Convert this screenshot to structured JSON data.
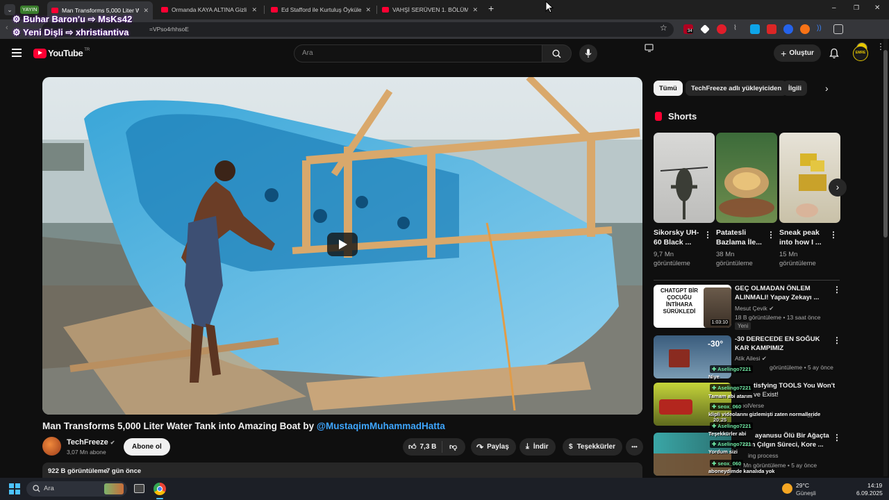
{
  "browser": {
    "live_badge": "YAYIN",
    "tabs": [
      {
        "title": "Man Transforms 5,000 Liter Wa",
        "active": true
      },
      {
        "title": "Ormanda KAYA ALTINA Gizli Ev"
      },
      {
        "title": "Ed Stafford ile Kurtuluş Öyküleri"
      },
      {
        "title": "VAHŞİ SERÜVEN 1. BÖLÜM | 4K"
      }
    ],
    "new_tab": "+",
    "url_fragment": "=VPso4rhhsoE",
    "window_controls": {
      "minimize": "–",
      "restore": "❐",
      "close": "✕"
    },
    "ext_badge": "34"
  },
  "stream_overlay": {
    "line1": "Buhar Baron'u ⇨ MsKs42",
    "line2": "Yeni Dişli ⇨ xhristiantiva"
  },
  "header": {
    "logo": "YouTube",
    "logo_region": "TR",
    "search_placeholder": "Ara",
    "create_label": "Oluştur",
    "avatar_label": "EMRE B."
  },
  "video": {
    "title_prefix": "Man Transforms 5,000 Liter Water Tank into Amazing Boat by ",
    "title_mention": "@MustaqimMuhammadHatta",
    "channel": "TechFreeze",
    "subscribers": "3,07 Mn abone",
    "subscribe_label": "Abone ol",
    "likes": "7,3 B",
    "share_label": "Paylaş",
    "download_label": "İndir",
    "thanks_label": "Teşekkürler",
    "more": "•••",
    "views": "922 B görüntüleme",
    "age": "7 gün önce"
  },
  "filter_chips": [
    "Tümü",
    "TechFreeze adlı yükleyiciden",
    "İlgili"
  ],
  "shorts": {
    "heading": "Shorts",
    "items": [
      {
        "title": "Sikorsky UH-60 Black ...",
        "views": "9,7 Mn görüntüleme"
      },
      {
        "title": "Patatesli Bazlama İle...",
        "views": "38 Mn görüntüleme"
      },
      {
        "title": "Sneak peak into how I ...",
        "views": "15 Mn görüntüleme"
      }
    ]
  },
  "recommendations": [
    {
      "title": "GEÇ OLMADAN ÖNLEM ALINMALI! Yapay Zekayı ...",
      "channel": "Mesut Çevik",
      "meta": "18 B görüntüleme • 13 saat önce",
      "badge": "Yeni",
      "duration": "1:03:10",
      "thumb_text": "CHATGPT BİR ÇOCUĞU İNTİHARA SÜRÜKLEDİ"
    },
    {
      "title": "-30 DERECEDE EN SOĞUK KAR KAMPIMIZ",
      "channel": "Atik Ailesi",
      "meta": "görüntüleme • 5 ay önce",
      "thumb_text": "-30°"
    },
    {
      "title": "tisfying TOOLS You Won't",
      "title2": "ve Exist!",
      "channel": "oolVerse",
      "meta": "ce"
    },
    {
      "title": "ayanusu Ölü Bir Ağaçta",
      "title2": "nun Çılgın Süreci, Kore ...",
      "channel": "ing process",
      "meta": "9 Mn görüntüleme • 5 ay önce"
    }
  ],
  "chat": [
    {
      "user": "Aselingo7221",
      "msg": "Niye"
    },
    {
      "user": "Aselingo7221",
      "msg": "Tamam abi atarım"
    },
    {
      "user": "seox_060",
      "msg": "klipli videolarını gizlemişti zaten normalleride"
    },
    {
      "user": "Aselingo7221",
      "msg": "Teşekkürler abi"
    },
    {
      "user": "Aselingo7221",
      "msg": "Yordum sizi"
    },
    {
      "user": "seox_060",
      "msg": "aboneydimde kanalıda yok"
    }
  ],
  "chat_time": "20:25",
  "taskbar": {
    "search_placeholder": "Ara",
    "weather_temp": "29°C",
    "weather_desc": "Güneşli",
    "time": "14:19",
    "date": "6.09.2025"
  }
}
